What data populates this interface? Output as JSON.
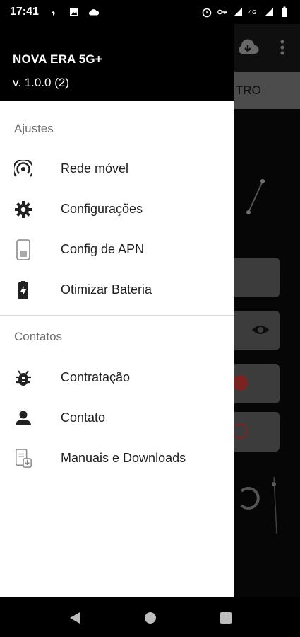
{
  "status_bar": {
    "time": "17:41",
    "left_icons": [
      "rocket-icon",
      "image-icon",
      "cloud-icon"
    ],
    "right_icons": [
      "alarm-icon",
      "vpn-key-icon",
      "signal-icon",
      "4g-icon",
      "signal-icon",
      "battery-icon"
    ]
  },
  "drawer": {
    "app_name": "NOVA ERA 5G+",
    "version": "v. 1.0.0 (2)",
    "sections": [
      {
        "title": "Ajustes",
        "items": [
          {
            "label": "Rede móvel",
            "icon": "cell-signal-icon"
          },
          {
            "label": "Configurações",
            "icon": "gear-icon"
          },
          {
            "label": "Config de APN",
            "icon": "sim-card-icon"
          },
          {
            "label": "Otimizar Bateria",
            "icon": "battery-charging-icon"
          }
        ]
      },
      {
        "title": "Contatos",
        "items": [
          {
            "label": "Contratação",
            "icon": "bug-icon"
          },
          {
            "label": "Contato",
            "icon": "person-icon"
          },
          {
            "label": "Manuais e Downloads",
            "icon": "document-download-icon"
          }
        ]
      }
    ]
  },
  "background": {
    "tab_label": "TRO"
  },
  "nav_bar": {
    "icons": [
      "back-icon",
      "home-icon",
      "recents-icon"
    ]
  }
}
